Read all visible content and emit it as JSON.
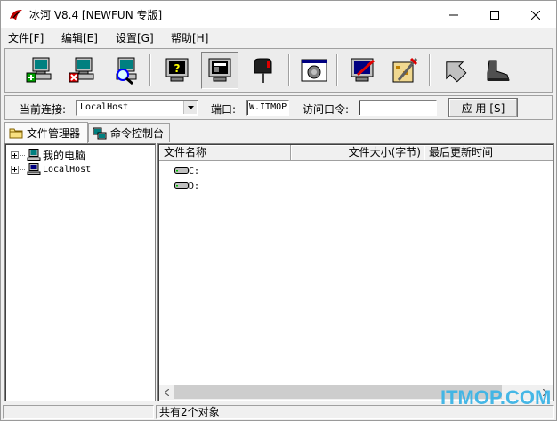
{
  "window": {
    "title": "冰河 V8.4 [NEWFUN 专版]"
  },
  "menu": {
    "items": [
      {
        "label": "文件[F]"
      },
      {
        "label": "编辑[E]"
      },
      {
        "label": "设置[G]"
      },
      {
        "label": "帮助[H]"
      }
    ]
  },
  "toolbar": {
    "buttons": [
      {
        "icon": "add-host-icon"
      },
      {
        "icon": "delete-host-icon"
      },
      {
        "icon": "search-host-icon"
      },
      {
        "icon": "unknown-monitor-icon"
      },
      {
        "icon": "screen-capture-icon"
      },
      {
        "icon": "mailbox-icon"
      },
      {
        "icon": "settings-dialog-icon"
      },
      {
        "icon": "edit-screen-icon"
      },
      {
        "icon": "config-tools-icon"
      },
      {
        "icon": "upgrade-arrow-icon"
      },
      {
        "icon": "boot-icon"
      }
    ]
  },
  "connection": {
    "current_label": "当前连接:",
    "current_value": "LocalHost",
    "port_label": "端口:",
    "port_value": "W.ITMOP",
    "password_label": "访问口令:",
    "password_value": "",
    "apply_label": "应 用 [S]"
  },
  "tabs": [
    {
      "label": "文件管理器"
    },
    {
      "label": "命令控制台"
    }
  ],
  "tree": {
    "nodes": [
      {
        "label": "我的电脑"
      },
      {
        "label": "LocalHost"
      }
    ]
  },
  "file_list": {
    "columns": [
      "文件名称",
      "文件大小(字节)",
      "最后更新时间"
    ],
    "rows": [
      {
        "name": "C:"
      },
      {
        "name": "D:"
      }
    ]
  },
  "status": {
    "text": "共有2个对象"
  },
  "watermark": {
    "text": "ITMOP.COM"
  },
  "colors": {
    "watermark": "#3cb4e6",
    "monitor_teal": "#008080",
    "title_bg": "#ffffff"
  }
}
